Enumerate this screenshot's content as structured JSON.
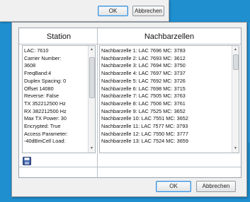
{
  "back_dialog": {
    "ok_label": "OK",
    "cancel_label": "Abbrechen"
  },
  "dialog": {
    "columns": {
      "station": "Station",
      "nachbarzellen": "Nachbarzellen"
    },
    "station_items": [
      "LAC: 7610",
      "Carrier Number:",
      "3608",
      "FreqBand:4",
      "Duplex Spacing: 0",
      "Offset 14080",
      "Reverse: False",
      "TX 352212500 Hz",
      "RX 382212500 Hz",
      "Max TX Power: 30",
      "Encrypted: True",
      "Access Parameter:",
      "-40dBmCell Load:"
    ],
    "neighbor_items": [
      "Nachbarzelle 1: LAC 7696  MC: 3783",
      "Nachbarzelle 2: LAC 7693  MC: 3612",
      "Nachbarzelle 3: LAC 7694  MC: 3750",
      "Nachbarzelle 4: LAC 7697  MC: 3737",
      "Nachbarzelle 5: LAC 7692  MC: 3726",
      "Nachbarzelle 6: LAC 7698  MC: 3715",
      "Nachbarzelle 7: LAC 7505  MC: 3763",
      "Nachbarzelle 8: LAC 7506  MC: 3761",
      "Nachbarzelle 9: LAC 7525  MC: 3652",
      "Nachbarzelle 10: LAC 7551  MC: 3652",
      "Nachbarzelle 11: LAC 7577  MC: 3793",
      "Nachbarzelle 12: LAC 7550  MC: 3777",
      "Nachbarzelle 13: LAC 7524  MC: 3659"
    ],
    "ok_label": "OK",
    "cancel_label": "Abbrechen"
  }
}
